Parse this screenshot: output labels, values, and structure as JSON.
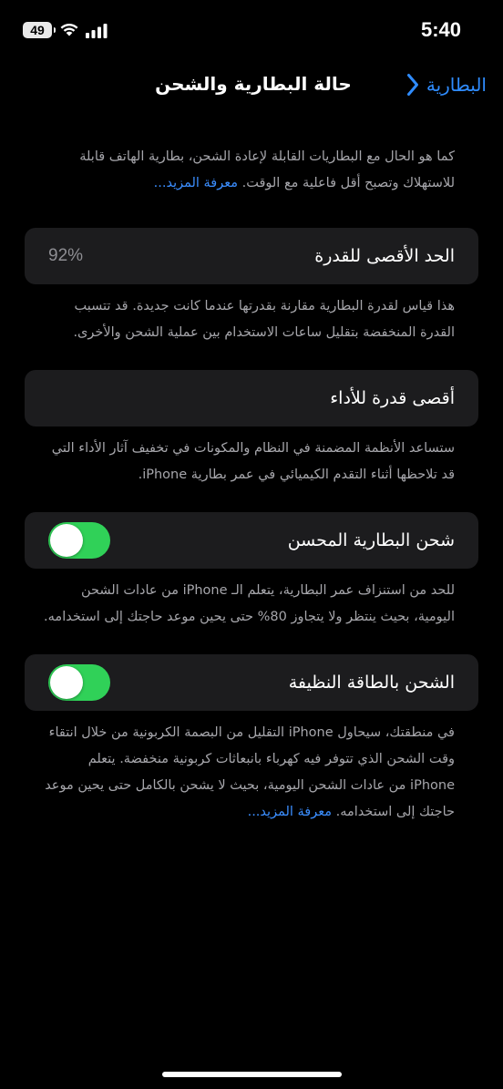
{
  "status_bar": {
    "time": "5:40",
    "battery_level": "49",
    "wifi_icon": "wifi-icon",
    "signal_icon": "cellular-signal-icon"
  },
  "nav": {
    "back_label": "البطارية",
    "back_icon": "chevron-right-icon",
    "title": "حالة البطارية والشحن",
    "accent_color": "#2f8cff"
  },
  "intro": {
    "text": "كما هو الحال مع البطاريات القابلة لإعادة الشحن، بطارية الهاتف قابلة للاستهلاك وتصبح أقل فاعلية مع الوقت.",
    "link": "معرفة المزيد..."
  },
  "max_capacity": {
    "label": "الحد الأقصى للقدرة",
    "value": "92%",
    "footnote": "هذا قياس لقدرة البطارية مقارنة بقدرتها عندما كانت جديدة. قد تتسبب القدرة المنخفضة بتقليل ساعات الاستخدام بين عملية الشحن والأخرى."
  },
  "peak_performance": {
    "label": "أقصى قدرة للأداء",
    "footnote": "ستساعد الأنظمة المضمنة في النظام والمكونات في تخفيف آثار الأداء التي قد تلاحظها أثناء التقدم الكيميائي في عمر بطارية iPhone."
  },
  "optimized_charging": {
    "label": "شحن البطارية المحسن",
    "enabled": true,
    "footnote": "للحد من استنزاف عمر البطارية، يتعلم الـ iPhone من عادات الشحن اليومية، بحيث ينتظر ولا يتجاوز 80% حتى يحين موعد حاجتك إلى استخدامه."
  },
  "clean_energy": {
    "label": "الشحن بالطاقة النظيفة",
    "enabled": true,
    "footnote": "في منطقتك، سيحاول iPhone التقليل من البصمة الكربونية من خلال انتقاء وقت الشحن الذي تتوفر فيه كهرباء بانبعاثات كربونية منخفضة. يتعلم iPhone من عادات الشحن اليومية، بحيث لا يشحن بالكامل حتى يحين موعد حاجتك إلى استخدامه.",
    "link": "معرفة المزيد..."
  },
  "colors": {
    "background": "#000000",
    "card": "#1c1c1e",
    "toggle_on": "#30d158",
    "footnote": "#a6a6ab"
  }
}
